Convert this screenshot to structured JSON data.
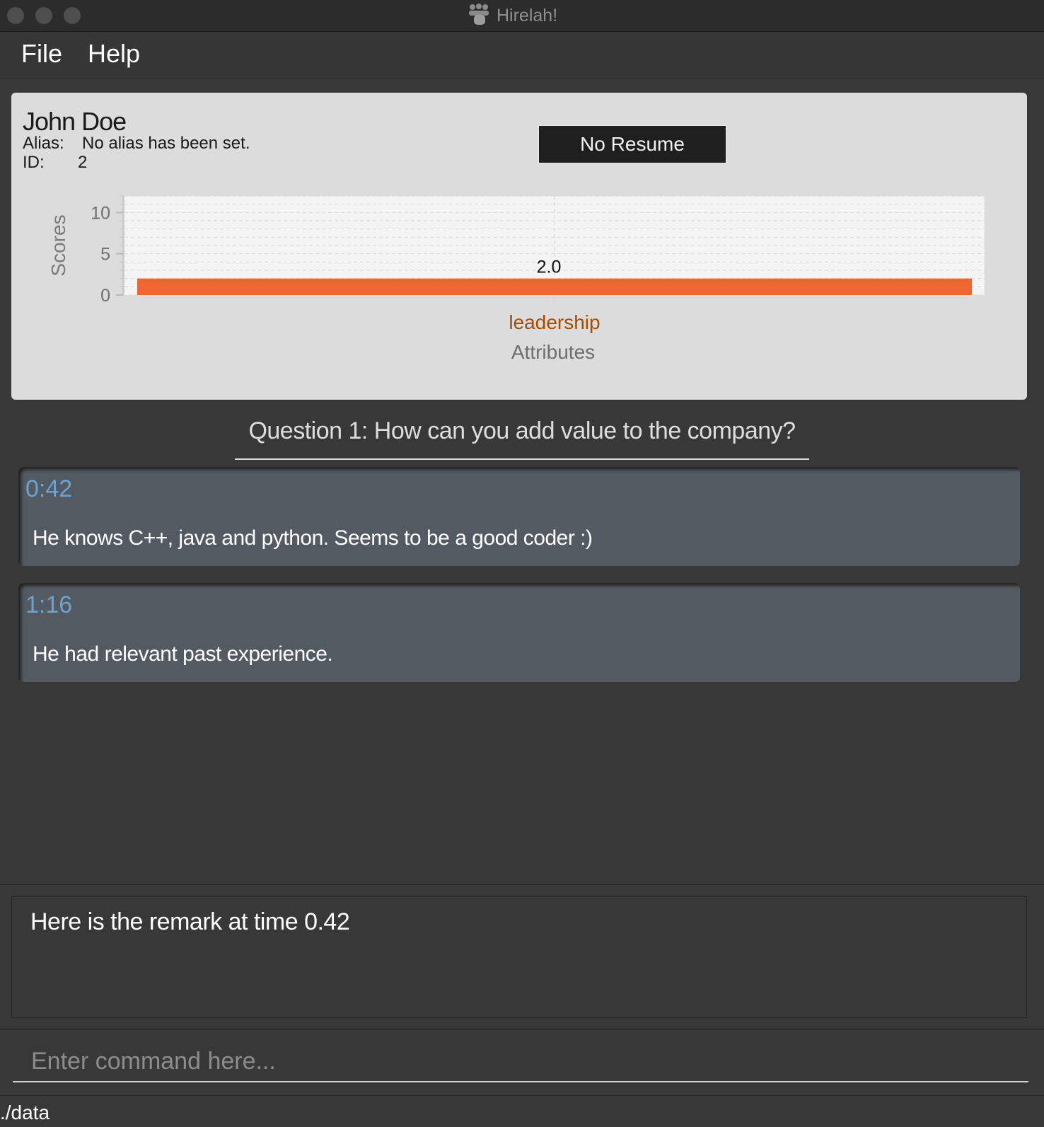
{
  "window": {
    "title": "Hirelah!",
    "app_icon": "people-icon"
  },
  "menu": {
    "items": [
      "File",
      "Help"
    ]
  },
  "interviewee": {
    "name": "John Doe",
    "alias_label": "Alias:",
    "alias_value": "No alias has been set.",
    "id_label": "ID:",
    "id_value": "2",
    "resume_button": "No Resume"
  },
  "chart_data": {
    "type": "bar",
    "orientation": "horizontal-values-on-y",
    "categories": [
      "leadership"
    ],
    "values": [
      2.0
    ],
    "data_labels": [
      "2.0"
    ],
    "xlabel": "Attributes",
    "ylabel": "Scores",
    "ylim": [
      0,
      12
    ],
    "yticks": [
      0,
      5,
      10
    ],
    "grid": true,
    "colors": {
      "bar": "#f06530",
      "category_label": "#a64b00"
    }
  },
  "question": {
    "text": "Question 1: How can you add  value to the company?"
  },
  "remarks": [
    {
      "time": "0:42",
      "text": "He knows C++, java and python. Seems to be a good coder :)"
    },
    {
      "time": "1:16",
      "text": "He had relevant past experience."
    }
  ],
  "result": {
    "text": "Here is the remark at time 0.42"
  },
  "command": {
    "placeholder": "Enter command here...",
    "value": ""
  },
  "status": {
    "path": "./data"
  },
  "colors": {
    "accent_time": "#6ba3d3",
    "background": "#383838",
    "card": "#dcdcdc"
  }
}
